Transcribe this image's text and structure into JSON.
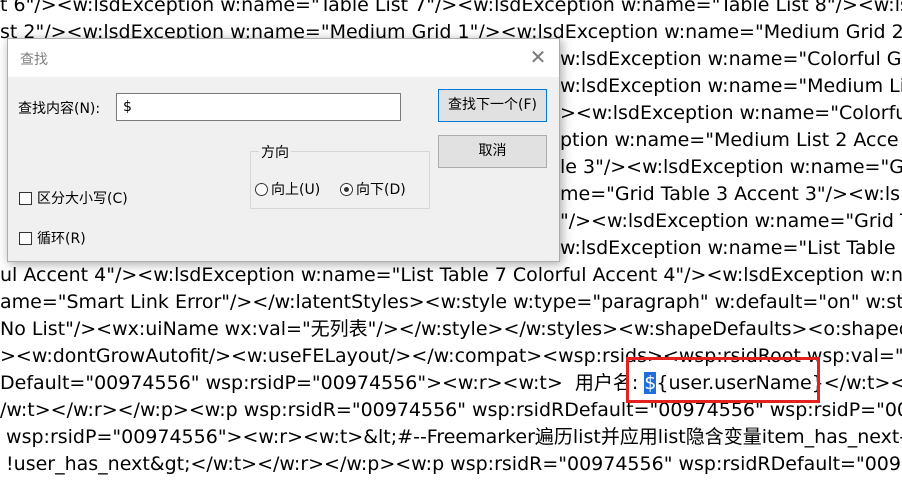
{
  "editor": {
    "lines": [
      "t 6\"/><w:lsdException w:name=\"Table List 7\"/><w:lsdException w:name=\"Table List 8\"/><w:lsdE",
      "st 2\"/><w:lsdException w:name=\"Medium Grid 1\"/><w:lsdException w:name=\"Medium Grid 2",
      "w:lsdException w:name=\"Colorful Grid Accent 1\"/><w:ls",
      "w:lsdException w:name=\"Medium List 2 Accent 3\"/><w:l",
      "><w:lsdException w:name=\"Colorful Grid Accent 4\"/><",
      "ption w:name=\"Medium List 2 Acce",
      "le 3\"/><w:lsdException w:name=\"Gr",
      "me=\"Grid Table 3 Accent 3\"/><w:ls",
      "\"/><w:lsdException w:name=\"Grid T",
      "w:lsdException w:name=\"List Table 2",
      "ul Accent 4\"/><w:lsdException w:name=\"List Table 7 Colorful Accent 4\"/><w:lsdException w:na",
      "ame=\"Smart Link Error\"/></w:latentStyles><w:style w:type=\"paragraph\" w:default=\"on\" w:sty",
      "No List\"/><wx:uiName wx:val=\"无列表\"/></w:style></w:styles><w:shapeDefaults><o:shapede",
      "><w:dontGrowAutofit/><w:useFELayout/></w:compat><wsp:rsids><wsp:rsidRoot wsp:val=\"00",
      "Default=\"00974556\" wsp:rsidP=\"00974556\"><w:r><w:t>  用户名: ",
      "/w:t></w:r></w:p><w:p wsp:rsidR=\"00974556\" wsp:rsidRDefault=\"00974556\" wsp:rsidP=\"00",
      " wsp:rsidP=\"00974556\"><w:r><w:t>&lt;#--Freemarker遍历list并应用list隐含变量item_has_next-",
      " !user_has_next&gt;</w:t></w:r></w:p><w:p wsp:rsidR=\"00974556\" wsp:rsidRDefault=\"0097"
    ],
    "match_selected": "$",
    "match_rest": "{user.userName}",
    "line15_tail": "</w:t></"
  },
  "dialog": {
    "title": "查找",
    "close_glyph": "✕",
    "find_label": "查找内容(N):",
    "find_value": "$",
    "find_next_button": "查找下一个(F)",
    "cancel_button": "取消",
    "direction_group": "方向",
    "up_label": "向上(U)",
    "down_label": "向下(D)",
    "direction_selected": "down",
    "match_case_label": "区分大小写(C)",
    "match_case_checked": false,
    "wrap_label": "循环(R)",
    "wrap_checked": false
  },
  "colors": {
    "selection": "#1e6fd9",
    "annotation_box": "#e3211f",
    "dialog_bg": "#f0f0f0"
  }
}
